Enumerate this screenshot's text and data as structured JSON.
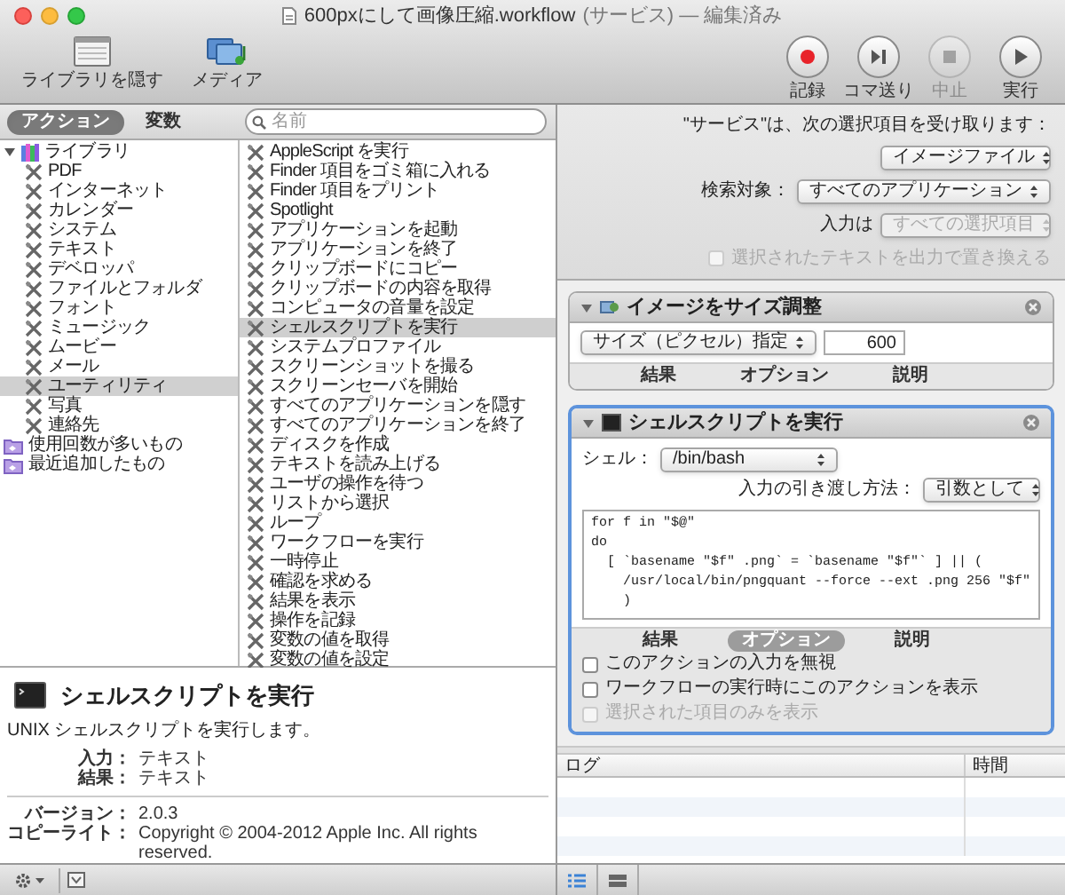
{
  "window": {
    "title": "600pxにして画像圧縮.workflow",
    "detail": "(サービス) — 編集済み"
  },
  "toolbar": {
    "left": [
      {
        "label": "ライブラリを隠す",
        "kind": "library"
      },
      {
        "label": "メディア",
        "kind": "media"
      }
    ],
    "right": [
      {
        "label": "記録",
        "kind": "record",
        "disabled": false
      },
      {
        "label": "コマ送り",
        "kind": "step",
        "disabled": false
      },
      {
        "label": "中止",
        "kind": "stop",
        "disabled": true
      },
      {
        "label": "実行",
        "kind": "run",
        "disabled": false
      }
    ]
  },
  "library": {
    "tabs": [
      {
        "label": "アクション",
        "selected": true
      },
      {
        "label": "変数",
        "selected": false
      }
    ],
    "search": {
      "placeholder": "名前"
    },
    "tree": [
      {
        "label": "ライブラリ",
        "kind": "library",
        "expanded": true,
        "selected": false,
        "children": [
          {
            "label": "PDF",
            "kind": "category",
            "selected": false
          },
          {
            "label": "インターネット",
            "kind": "category",
            "selected": false
          },
          {
            "label": "カレンダー",
            "kind": "category",
            "selected": false
          },
          {
            "label": "システム",
            "kind": "category",
            "selected": false
          },
          {
            "label": "テキスト",
            "kind": "category",
            "selected": false
          },
          {
            "label": "デベロッパ",
            "kind": "category",
            "selected": false
          },
          {
            "label": "ファイルとフォルダ",
            "kind": "category",
            "selected": false
          },
          {
            "label": "フォント",
            "kind": "category",
            "selected": false
          },
          {
            "label": "ミュージック",
            "kind": "category",
            "selected": false
          },
          {
            "label": "ムービー",
            "kind": "category",
            "selected": false
          },
          {
            "label": "メール",
            "kind": "category",
            "selected": false
          },
          {
            "label": "ユーティリティ",
            "kind": "category",
            "selected": true
          },
          {
            "label": "写真",
            "kind": "category",
            "selected": false
          },
          {
            "label": "連絡先",
            "kind": "category",
            "selected": false
          }
        ]
      },
      {
        "label": "使用回数が多いもの",
        "kind": "smart-folder",
        "selected": false
      },
      {
        "label": "最近追加したもの",
        "kind": "smart-folder",
        "selected": false
      }
    ],
    "actions": [
      {
        "label": "AppleScript を実行",
        "selected": false
      },
      {
        "label": "Finder 項目をゴミ箱に入れる",
        "selected": false
      },
      {
        "label": "Finder 項目をプリント",
        "selected": false
      },
      {
        "label": "Spotlight",
        "selected": false
      },
      {
        "label": "アプリケーションを起動",
        "selected": false
      },
      {
        "label": "アプリケーションを終了",
        "selected": false
      },
      {
        "label": "クリップボードにコピー",
        "selected": false
      },
      {
        "label": "クリップボードの内容を取得",
        "selected": false
      },
      {
        "label": "コンピュータの音量を設定",
        "selected": false
      },
      {
        "label": "シェルスクリプトを実行",
        "selected": true
      },
      {
        "label": "システムプロファイル",
        "selected": false
      },
      {
        "label": "スクリーンショットを撮る",
        "selected": false
      },
      {
        "label": "スクリーンセーバを開始",
        "selected": false
      },
      {
        "label": "すべてのアプリケーションを隠す",
        "selected": false
      },
      {
        "label": "すべてのアプリケーションを終了",
        "selected": false
      },
      {
        "label": "ディスクを作成",
        "selected": false
      },
      {
        "label": "テキストを読み上げる",
        "selected": false
      },
      {
        "label": "ユーザの操作を待つ",
        "selected": false
      },
      {
        "label": "リストから選択",
        "selected": false
      },
      {
        "label": "ループ",
        "selected": false
      },
      {
        "label": "ワークフローを実行",
        "selected": false
      },
      {
        "label": "一時停止",
        "selected": false
      },
      {
        "label": "確認を求める",
        "selected": false
      },
      {
        "label": "結果を表示",
        "selected": false
      },
      {
        "label": "操作を記録",
        "selected": false
      },
      {
        "label": "変数の値を取得",
        "selected": false
      },
      {
        "label": "変数の値を設定",
        "selected": false
      }
    ]
  },
  "description": {
    "title": "シェルスクリプトを実行",
    "summary": "UNIX シェルスクリプトを実行します。",
    "io": [
      {
        "label": "入力：",
        "value": "テキスト"
      },
      {
        "label": "結果：",
        "value": "テキスト"
      }
    ],
    "meta": [
      {
        "label": "バージョン：",
        "value": "2.0.3"
      },
      {
        "label": "コピーライト：",
        "value": "Copyright © 2004-2012 Apple Inc.  All rights reserved."
      }
    ]
  },
  "service": {
    "receives_label": "\"サービス\"は、次の選択項目を受け取ります：",
    "receives_value": "イメージファイル",
    "target_label": "検索対象：",
    "target_value": "すべてのアプリケーション",
    "input_label": "入力は",
    "input_value": "すべての選択項目",
    "input_disabled": true,
    "replace": {
      "label": "選択されたテキストを出力で置き換える",
      "checked": false,
      "disabled": true
    }
  },
  "workflow": [
    {
      "kind": "resize",
      "title": "イメージをサイズ調整",
      "expanded": true,
      "selected": false,
      "popup": "サイズ（ピクセル）指定",
      "value": "600",
      "tabs": [
        {
          "label": "結果",
          "selected": false
        },
        {
          "label": "オプション",
          "selected": false
        },
        {
          "label": "説明",
          "selected": false
        }
      ]
    },
    {
      "kind": "shell",
      "title": "シェルスクリプトを実行",
      "expanded": true,
      "selected": true,
      "shell_label": "シェル：",
      "shell": "/bin/bash",
      "pass_label": "入力の引き渡し方法：",
      "pass": "引数として",
      "script": "for f in \"$@\"\ndo\n  [ `basename \"$f\" .png` = `basename \"$f\"` ] || (\n    /usr/local/bin/pngquant --force --ext .png 256 \"$f\"\n    )",
      "tabs": [
        {
          "label": "結果",
          "selected": false
        },
        {
          "label": "オプション",
          "selected": true
        },
        {
          "label": "説明",
          "selected": false
        }
      ],
      "options": [
        {
          "label": "このアクションの入力を無視",
          "checked": false,
          "disabled": false
        },
        {
          "label": "ワークフローの実行時にこのアクションを表示",
          "checked": false,
          "disabled": false
        },
        {
          "label": "選択された項目のみを表示",
          "checked": false,
          "disabled": true
        }
      ]
    }
  ],
  "log": {
    "columns": [
      "ログ",
      "時間"
    ]
  }
}
